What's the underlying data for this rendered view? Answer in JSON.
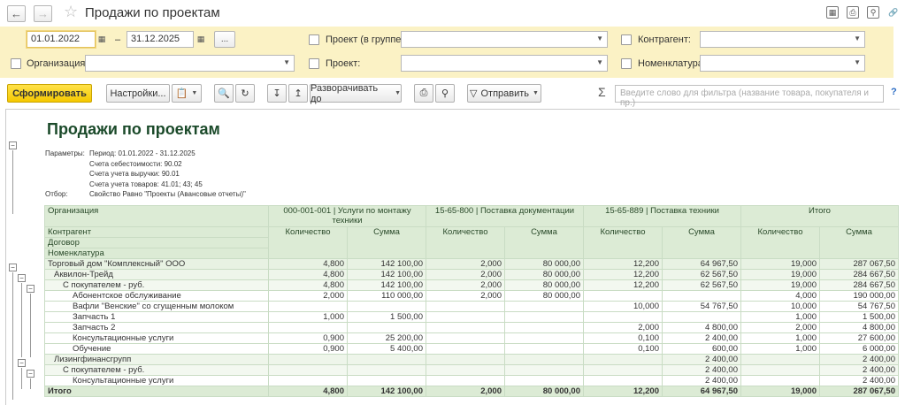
{
  "window": {
    "title": "Продажи по проектам"
  },
  "filters": {
    "date_from": "01.01.2022",
    "date_to": "31.12.2025",
    "dash": "–",
    "more": "...",
    "org_label": "Организация:",
    "project_group_label": "Проект (в группе):",
    "project_label": "Проект:",
    "contractor_label": "Контрагент:",
    "nomenclature_label": "Номенклатура:"
  },
  "toolbar": {
    "generate": "Сформировать",
    "settings": "Настройки...",
    "expand_to": "Разворачивать до",
    "send": "Отправить",
    "filter_placeholder": "Введите слово для фильтра (название товара, покупателя и пр.)",
    "help": "?"
  },
  "report": {
    "title": "Продажи по проектам",
    "params": [
      {
        "label": "Параметры:",
        "value": "Период: 01.01.2022 - 31.12.2025"
      },
      {
        "label": "",
        "value": "Счета себестоимости: 90.02"
      },
      {
        "label": "",
        "value": "Счета учета выручки: 90.01"
      },
      {
        "label": "",
        "value": "Счета учета товаров: 41.01; 43; 45"
      },
      {
        "label": "Отбор:",
        "value": "Свойство Равно \"Проекты (Авансовые отчеты)\""
      }
    ],
    "header": {
      "org": "Организация",
      "contractor": "Контрагент",
      "contract": "Договор",
      "nomenclature": "Номенклатура",
      "projects": [
        "000-001-001 | Услуги по монтажу техники",
        "15-65-800 | Поставка документации",
        "15-65-889 | Поставка техники",
        "Итого"
      ],
      "qty": "Количество",
      "sum": "Сумма"
    },
    "rows": [
      {
        "level": 0,
        "name": "Торговый дом \"Комплексный\" ООО",
        "v": [
          "4,800",
          "142 100,00",
          "2,000",
          "80 000,00",
          "12,200",
          "64 967,50",
          "19,000",
          "287 067,50"
        ]
      },
      {
        "level": 1,
        "name": "Аквилон-Трейд",
        "v": [
          "4,800",
          "142 100,00",
          "2,000",
          "80 000,00",
          "12,200",
          "62 567,50",
          "19,000",
          "284 667,50"
        ]
      },
      {
        "level": 2,
        "name": "С покупателем - руб.",
        "v": [
          "4,800",
          "142 100,00",
          "2,000",
          "80 000,00",
          "12,200",
          "62 567,50",
          "19,000",
          "284 667,50"
        ]
      },
      {
        "level": 3,
        "name": "Абонентское обслуживание",
        "v": [
          "2,000",
          "110 000,00",
          "2,000",
          "80 000,00",
          "",
          "",
          "4,000",
          "190 000,00"
        ]
      },
      {
        "level": 3,
        "name": "Вафли \"Венские\" со сгущенным молоком",
        "v": [
          "",
          "",
          "",
          "",
          "10,000",
          "54 767,50",
          "10,000",
          "54 767,50"
        ]
      },
      {
        "level": 3,
        "name": "Запчасть 1",
        "v": [
          "1,000",
          "1 500,00",
          "",
          "",
          "",
          "",
          "1,000",
          "1 500,00"
        ]
      },
      {
        "level": 3,
        "name": "Запчасть 2",
        "v": [
          "",
          "",
          "",
          "",
          "2,000",
          "4 800,00",
          "2,000",
          "4 800,00"
        ]
      },
      {
        "level": 3,
        "name": "Консультационные услуги",
        "v": [
          "0,900",
          "25 200,00",
          "",
          "",
          "0,100",
          "2 400,00",
          "1,000",
          "27 600,00"
        ]
      },
      {
        "level": 3,
        "name": "Обучение",
        "v": [
          "0,900",
          "5 400,00",
          "",
          "",
          "0,100",
          "600,00",
          "1,000",
          "6 000,00"
        ]
      },
      {
        "level": 1,
        "name": "Лизингфинансгрупп",
        "v": [
          "",
          "",
          "",
          "",
          "",
          "2 400,00",
          "",
          "2 400,00"
        ]
      },
      {
        "level": 2,
        "name": "С покупателем - руб.",
        "v": [
          "",
          "",
          "",
          "",
          "",
          "2 400,00",
          "",
          "2 400,00"
        ]
      },
      {
        "level": 3,
        "name": "Консультационные услуги",
        "v": [
          "",
          "",
          "",
          "",
          "",
          "2 400,00",
          "",
          "2 400,00"
        ]
      }
    ],
    "total": {
      "name": "Итого",
      "v": [
        "4,800",
        "142 100,00",
        "2,000",
        "80 000,00",
        "12,200",
        "64 967,50",
        "19,000",
        "287 067,50"
      ]
    }
  }
}
